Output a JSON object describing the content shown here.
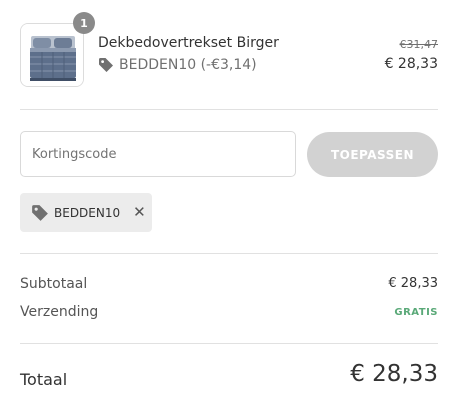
{
  "product": {
    "quantity": "1",
    "name": "Dekbedovertrekset Birger",
    "discount_text": "BEDDEN10 (-€3,14)",
    "price_original": "€31,47",
    "price_current": "€ 28,33",
    "image_icon": "duvet-cover-thumbnail"
  },
  "coupon": {
    "placeholder": "Kortingscode",
    "apply_label": "TOEPASSEN",
    "applied_code": "BEDDEN10",
    "remove_icon": "close-icon"
  },
  "summary": {
    "subtotal_label": "Subtotaal",
    "subtotal_value": "€ 28,33",
    "shipping_label": "Verzending",
    "shipping_value": "GRATIS",
    "total_label": "Totaal",
    "total_value": "€ 28,33"
  },
  "colors": {
    "free_shipping": "#5aa978",
    "apply_button_disabled": "#d2d2d2",
    "badge": "#8a8a8a"
  }
}
